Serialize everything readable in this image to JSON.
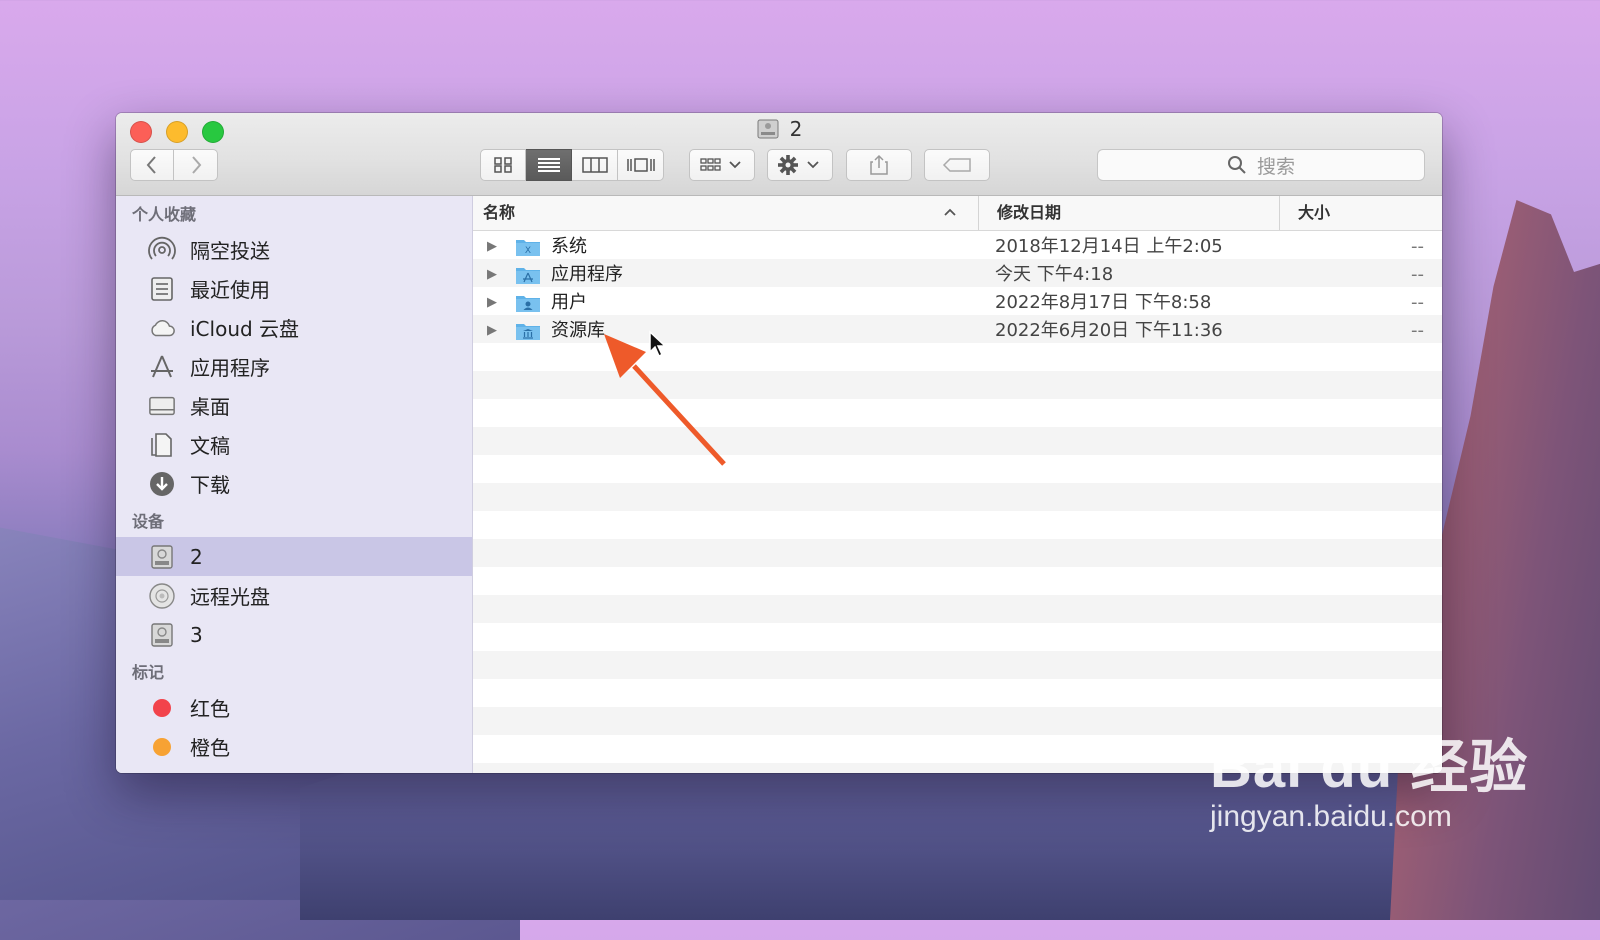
{
  "window": {
    "title": "2",
    "search_placeholder": "搜索"
  },
  "toolbar": {
    "back_icon": "chevron-left-icon",
    "forward_icon": "chevron-right-icon",
    "views": [
      "icon-view",
      "list-view",
      "column-view",
      "cover-flow-view"
    ],
    "active_view": "list-view"
  },
  "sidebar": {
    "favorites_title": "个人收藏",
    "favorites": [
      {
        "label": "隔空投送",
        "icon": "airdrop-icon"
      },
      {
        "label": "最近使用",
        "icon": "recents-icon"
      },
      {
        "label": "iCloud 云盘",
        "icon": "cloud-icon"
      },
      {
        "label": "应用程序",
        "icon": "applications-icon"
      },
      {
        "label": "桌面",
        "icon": "desktop-icon"
      },
      {
        "label": "文稿",
        "icon": "documents-icon"
      },
      {
        "label": "下载",
        "icon": "downloads-icon"
      }
    ],
    "devices_title": "设备",
    "devices": [
      {
        "label": "2",
        "icon": "disk-icon",
        "selected": true
      },
      {
        "label": "远程光盘",
        "icon": "optical-disc-icon"
      },
      {
        "label": "3",
        "icon": "disk-icon"
      }
    ],
    "tags_title": "标记",
    "tags": [
      {
        "label": "红色",
        "color": "#f2434b"
      },
      {
        "label": "橙色",
        "color": "#f7a233"
      }
    ]
  },
  "columns": {
    "name": "名称",
    "date": "修改日期",
    "size": "大小"
  },
  "files": [
    {
      "name": "系统",
      "date": "2018年12月14日 上午2:05",
      "size": "--",
      "icon": "system-folder-icon"
    },
    {
      "name": "应用程序",
      "date": "今天 下午4:18",
      "size": "--",
      "icon": "applications-folder-icon"
    },
    {
      "name": "用户",
      "date": "2022年8月17日 下午8:58",
      "size": "--",
      "icon": "users-folder-icon"
    },
    {
      "name": "资源库",
      "date": "2022年6月20日 下午11:36",
      "size": "--",
      "icon": "library-folder-icon"
    }
  ],
  "watermark": {
    "brand": "Bai du 经验",
    "url": "jingyan.baidu.com"
  },
  "colors": {
    "close": "#fc5f57",
    "minimize": "#fdbb2d",
    "maximize": "#28c840",
    "folder": "#5fb2e8",
    "annotation_arrow": "#ee5a2a",
    "sidebar_selected": "#c9c6e6"
  }
}
